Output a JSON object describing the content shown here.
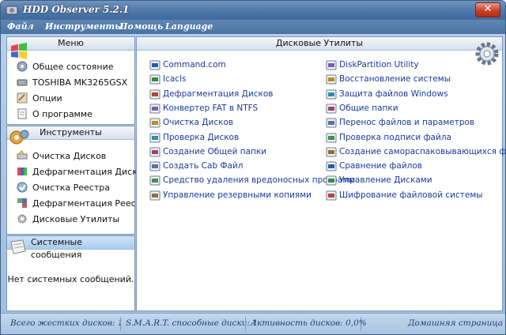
{
  "window": {
    "title": "HDD Observer 5.2.1",
    "close_glyph": "✕"
  },
  "menubar": {
    "items": [
      "Файл",
      "Инструменты",
      "Помощь",
      "Language"
    ]
  },
  "menu_panel": {
    "title": "Меню",
    "items": [
      {
        "label": "Общее состояние",
        "icon": "status-icon"
      },
      {
        "label": "TOSHIBA MK3265GSX",
        "icon": "disk-icon"
      },
      {
        "label": "Опции",
        "icon": "options-icon"
      },
      {
        "label": "О программе",
        "icon": "about-icon"
      }
    ]
  },
  "tools_panel": {
    "title": "Инструменты",
    "items": [
      {
        "label": "Очистка Дисков",
        "icon": "disk-cleanup-icon"
      },
      {
        "label": "Дефрагментация Дисков",
        "icon": "defrag-icon"
      },
      {
        "label": "Очистка Реестра",
        "icon": "registry-cleanup-icon"
      },
      {
        "label": "Дефрагментация Реестра",
        "icon": "registry-defrag-icon"
      },
      {
        "label": "Дисковые Утилиты",
        "icon": "disk-utilities-icon"
      }
    ]
  },
  "messages_panel": {
    "title": "Системные сообщения",
    "text": "Нет системных сообщений."
  },
  "utilities_panel": {
    "title": "Дисковые Утилиты",
    "left_links": [
      "Command.com",
      "Icacls",
      "Дефрагментация Дисков",
      "Конвертер FAT в NTFS",
      "Очистка Дисков",
      "Проверка Дисков",
      "Создание Общей папки",
      "Создать Cab Файл",
      "Средство удаления вредоносных программ",
      "Управление резервными копиями"
    ],
    "right_links": [
      "DiskPartition Utility",
      "Восстановление системы",
      "Защита файлов Windows",
      "Общие папки",
      "Перенос файлов и параметров",
      "Проверка подписи файла",
      "Создание самораспаковывающихся файлов",
      "Сравнение файлов",
      "Управление Дисками",
      "Шифрование файловой системы"
    ]
  },
  "statusbar": {
    "total_disks": "Всего жестких дисков: 1",
    "smart_disks": "S.M.A.R.T. способные диски: 1",
    "activity": "Активность дисков: 0,0%",
    "home": "Домашняя страница"
  },
  "colors": {
    "link": "#1a3a9a",
    "titlebar": "#4c76a7",
    "close": "#c8412a"
  }
}
